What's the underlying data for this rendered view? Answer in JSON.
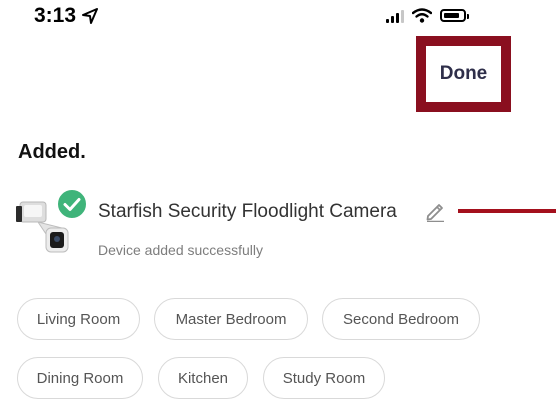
{
  "status_bar": {
    "time": "3:13",
    "icons": [
      "location-arrow-icon",
      "cellular-signal-icon",
      "wifi-icon",
      "battery-icon"
    ]
  },
  "header": {
    "done_label": "Done"
  },
  "main": {
    "heading": "Added.",
    "device": {
      "name": "Starfish Security Floodlight Camera",
      "status": "Device added successfully",
      "icons": [
        "floodlight-camera-icon",
        "success-check-icon",
        "pencil-edit-icon"
      ]
    },
    "rooms": [
      "Living Room",
      "Master Bedroom",
      "Second Bedroom",
      "Dining Room",
      "Kitchen",
      "Study Room"
    ]
  },
  "colors": {
    "annotation_red": "#8a0f1f",
    "success_green": "#3fb47a",
    "done_text": "#2f2f4a"
  }
}
